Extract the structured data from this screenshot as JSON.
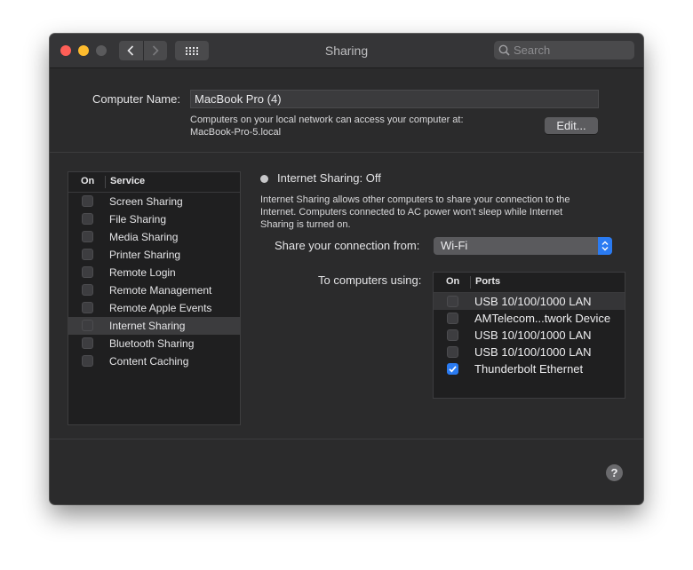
{
  "window": {
    "title": "Sharing"
  },
  "search": {
    "placeholder": "Search"
  },
  "computer_name": {
    "label": "Computer Name:",
    "value": "MacBook Pro (4)",
    "info_line1": "Computers on your local network can access your computer at:",
    "info_line2": "MacBook-Pro-5.local",
    "edit_label": "Edit..."
  },
  "services": {
    "col_on": "On",
    "col_service": "Service",
    "selected_index": 7,
    "items": [
      {
        "label": "Screen Sharing",
        "checked": false
      },
      {
        "label": "File Sharing",
        "checked": false
      },
      {
        "label": "Media Sharing",
        "checked": false
      },
      {
        "label": "Printer Sharing",
        "checked": false
      },
      {
        "label": "Remote Login",
        "checked": false
      },
      {
        "label": "Remote Management",
        "checked": false
      },
      {
        "label": "Remote Apple Events",
        "checked": false
      },
      {
        "label": "Internet Sharing",
        "checked": false
      },
      {
        "label": "Bluetooth Sharing",
        "checked": false
      },
      {
        "label": "Content Caching",
        "checked": false
      }
    ]
  },
  "detail": {
    "status": "Internet Sharing: Off",
    "desc_line1": "Internet Sharing allows other computers to share your connection to the",
    "desc_line2": "Internet. Computers connected to AC power won't sleep while Internet",
    "desc_line3": "Sharing is turned on.",
    "share_from_label": "Share your connection from:",
    "share_from_value": "Wi-Fi",
    "to_computers_label": "To computers using:",
    "ports_col_on": "On",
    "ports_col_ports": "Ports",
    "ports": [
      {
        "label": "USB 10/100/1000 LAN",
        "checked": false
      },
      {
        "label": "AMTelecom...twork Device",
        "checked": false
      },
      {
        "label": "USB 10/100/1000 LAN",
        "checked": false
      },
      {
        "label": "USB 10/100/1000 LAN",
        "checked": false
      },
      {
        "label": "Thunderbolt Ethernet",
        "checked": true
      }
    ]
  },
  "help": {
    "label": "?"
  },
  "colors": {
    "accent": "#2a7bf2",
    "window_bg": "#2b2b2c",
    "list_bg": "#1f1f20"
  }
}
